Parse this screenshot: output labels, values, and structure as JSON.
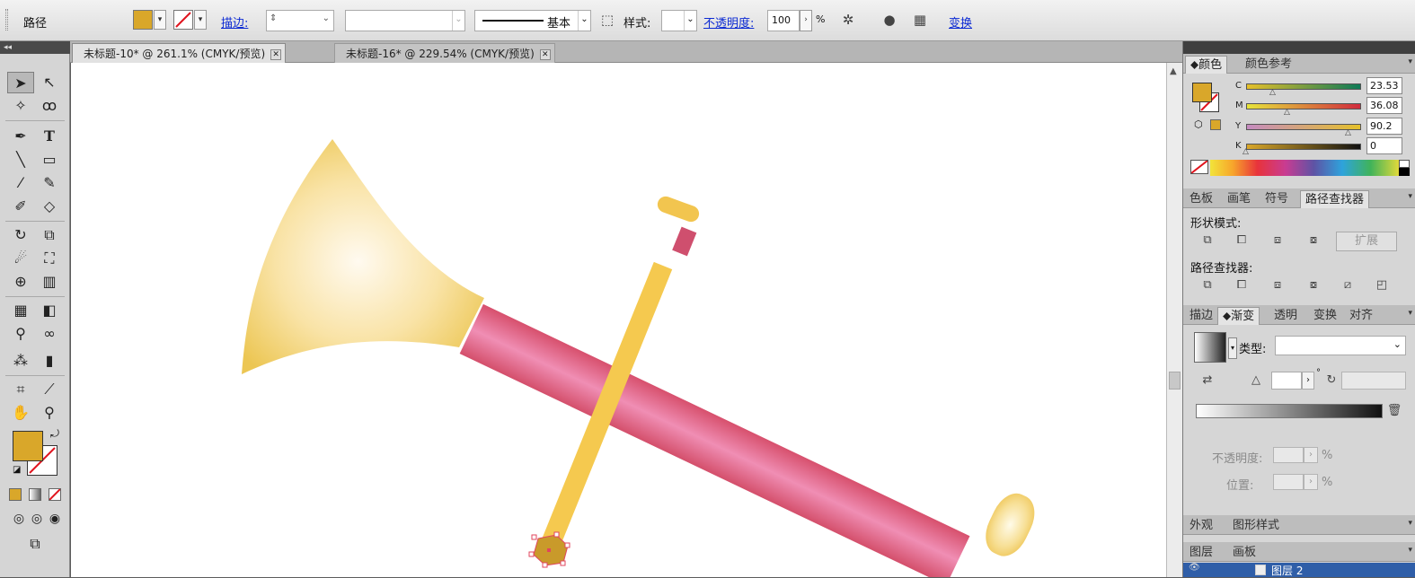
{
  "control_bar": {
    "object_type": "路径",
    "stroke_label": "描边:",
    "brush_style_label": "基本",
    "style_label": "样式:",
    "opacity_label": "不透明度:",
    "opacity_value": "100",
    "opacity_unit": "%",
    "transform_label": "变换",
    "fill_color": "#d9a72a"
  },
  "document_tabs": [
    {
      "label": "未标题-10* @ 261.1% (CMYK/预览)",
      "active": true
    },
    {
      "label": "未标题-16* @ 229.54% (CMYK/预览)",
      "active": false
    }
  ],
  "toolbox": {
    "collapse_label": "◂◂",
    "fill_color": "#d9a72a"
  },
  "color_panel": {
    "tabs": [
      "颜色",
      "颜色参考"
    ],
    "channels": [
      {
        "name": "C",
        "value": "23.53"
      },
      {
        "name": "M",
        "value": "36.08"
      },
      {
        "name": "Y",
        "value": "90.2"
      },
      {
        "name": "K",
        "value": "0"
      }
    ]
  },
  "pathfinder_panel": {
    "tabs": [
      "色板",
      "画笔",
      "符号",
      "路径查找器"
    ],
    "shape_modes_label": "形状模式:",
    "expand_label": "扩展",
    "pathfinders_label": "路径查找器:"
  },
  "gradient_panel": {
    "tabs": [
      "描边",
      "渐变",
      "透明",
      "变换",
      "对齐"
    ],
    "type_label": "类型:",
    "angle_unit": "°",
    "opacity_label": "不透明度:",
    "location_label": "位置:",
    "percent": "%"
  },
  "appearance_panel": {
    "tabs": [
      "外观",
      "图形样式"
    ]
  },
  "layers_panel": {
    "tabs": [
      "图层",
      "画板"
    ],
    "layer_name": "图层 2"
  }
}
